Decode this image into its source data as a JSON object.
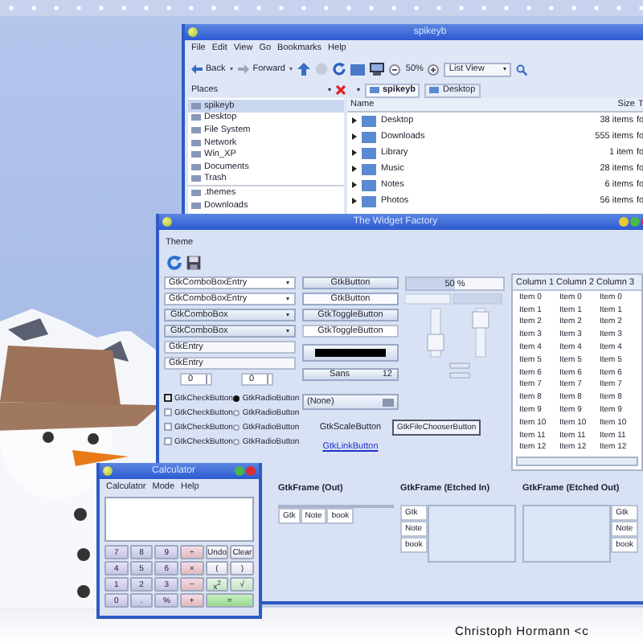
{
  "desktop": {
    "caption": "Christoph Hormann <c"
  },
  "file_manager": {
    "title": "spikeyb",
    "menu": [
      "File",
      "Edit",
      "View",
      "Go",
      "Bookmarks",
      "Help"
    ],
    "toolbar": {
      "back": "Back",
      "forward": "Forward",
      "zoom": "50%",
      "view": "List View"
    },
    "places": {
      "label": "Places",
      "items": [
        {
          "label": "spikeyb",
          "selected": true
        },
        {
          "label": "Desktop",
          "selected": false
        },
        {
          "label": "File System",
          "selected": false
        },
        {
          "label": "Network",
          "selected": false
        },
        {
          "label": "Win_XP",
          "selected": false
        },
        {
          "label": "Documents",
          "selected": false
        },
        {
          "label": "Trash",
          "selected": false
        },
        {
          "label": ".themes",
          "selected": false
        },
        {
          "label": "Downloads",
          "selected": false
        }
      ]
    },
    "path": [
      {
        "label": "spikeyb",
        "selected": true
      },
      {
        "label": "Desktop",
        "selected": false
      }
    ],
    "columns": [
      "Name",
      "Size",
      "T"
    ],
    "rows": [
      {
        "name": "Desktop",
        "size": "38 items",
        "type": "fo"
      },
      {
        "name": "Downloads",
        "size": "555 items",
        "type": "fo"
      },
      {
        "name": "Library",
        "size": "1 item",
        "type": "fo"
      },
      {
        "name": "Music",
        "size": "28 items",
        "type": "fo"
      },
      {
        "name": "Notes",
        "size": "6 items",
        "type": "fo"
      },
      {
        "name": "Photos",
        "size": "56 items",
        "type": "fo"
      }
    ]
  },
  "widget_factory": {
    "title": "The Widget Factory",
    "menu": [
      "Theme"
    ],
    "combos": [
      {
        "kind": "entry",
        "text": "GtkComboBoxEntry"
      },
      {
        "kind": "entry",
        "text": "GtkComboBoxEntry"
      },
      {
        "kind": "combo",
        "text": "GtkComboBox"
      },
      {
        "kind": "combo",
        "text": "GtkComboBox"
      }
    ],
    "entries": [
      "GtkEntry",
      "GtkEntry"
    ],
    "spins": [
      "0",
      "0"
    ],
    "checks": [
      {
        "label": "GtkCheckButton",
        "checked": true
      },
      {
        "label": "GtkCheckButton",
        "checked": false
      },
      {
        "label": "GtkCheckButton",
        "checked": false
      },
      {
        "label": "GtkCheckButton",
        "checked": false
      }
    ],
    "radios": [
      {
        "label": "GtkRadioButton",
        "selected": true
      },
      {
        "label": "GtkRadioButton",
        "selected": false
      },
      {
        "label": "GtkRadioButton",
        "selected": false
      },
      {
        "label": "GtkRadioButton",
        "selected": false
      }
    ],
    "buttons": [
      {
        "kind": "normal",
        "label": "GtkButton"
      },
      {
        "kind": "flat",
        "label": "GtkButton"
      },
      {
        "kind": "toggle",
        "label": "GtkToggleButton",
        "on": false
      },
      {
        "kind": "toggle",
        "label": "GtkToggleButton",
        "on": true
      }
    ],
    "font_button": {
      "name": "Sans",
      "size": "12"
    },
    "file_chooser": "(None)",
    "tooltip": "GtkFileChooserButton",
    "scale_button": "GtkScaleButton",
    "link_button": "GtkLinkButton",
    "progress": {
      "level": 0.5,
      "text": "50 %"
    },
    "tree": {
      "columns": [
        "Column 1",
        "Column 2",
        "Column 3"
      ],
      "rows": [
        [
          "Item 0",
          "Item 0",
          "Item 0"
        ],
        [
          "Item 1",
          "Item 1",
          "Item 1"
        ],
        [
          "Item 2",
          "Item 2",
          "Item 2"
        ],
        [
          "Item 3",
          "Item 3",
          "Item 3"
        ],
        [
          "Item 4",
          "Item 4",
          "Item 4"
        ],
        [
          "Item 5",
          "Item 5",
          "Item 5"
        ],
        [
          "Item 6",
          "Item 6",
          "Item 6"
        ],
        [
          "Item 7",
          "Item 7",
          "Item 7"
        ],
        [
          "Item 8",
          "Item 8",
          "Item 8"
        ],
        [
          "Item 9",
          "Item 9",
          "Item 9"
        ],
        [
          "Item 10",
          "Item 10",
          "Item 10"
        ],
        [
          "Item 11",
          "Item 11",
          "Item 11"
        ],
        [
          "Item 12",
          "Item 12",
          "Item 12"
        ]
      ]
    },
    "frames": [
      {
        "title": "GtkFrame (Out)",
        "kind": "bottom",
        "tabs": [
          "Gtk",
          "Note",
          "book"
        ]
      },
      {
        "title": "GtkFrame (Etched In)",
        "kind": "left",
        "tabs": [
          "Gtk",
          "Note",
          "book"
        ]
      },
      {
        "title": "GtkFrame (Etched Out)",
        "kind": "right",
        "tabs": [
          "Gtk",
          "Note",
          "book"
        ]
      }
    ]
  },
  "calculator": {
    "title": "Calculator",
    "menu": [
      "Calculator",
      "Mode",
      "Help"
    ],
    "keys": [
      {
        "label": "7",
        "kind": "digit"
      },
      {
        "label": "8",
        "kind": "digit"
      },
      {
        "label": "9",
        "kind": "digit"
      },
      {
        "label": "÷",
        "kind": "operator"
      },
      {
        "label": "Undo",
        "kind": "function"
      },
      {
        "label": "Clear",
        "kind": "function"
      },
      {
        "label": "4",
        "kind": "digit"
      },
      {
        "label": "5",
        "kind": "digit"
      },
      {
        "label": "6",
        "kind": "digit"
      },
      {
        "label": "×",
        "kind": "operator"
      },
      {
        "label": "(",
        "kind": "function"
      },
      {
        "label": ")",
        "kind": "function"
      },
      {
        "label": "1",
        "kind": "digit"
      },
      {
        "label": "2",
        "kind": "digit"
      },
      {
        "label": "3",
        "kind": "digit"
      },
      {
        "label": "−",
        "kind": "operator"
      },
      {
        "label": "x$^{2}$",
        "kind": "science"
      },
      {
        "label": "√",
        "kind": "science"
      },
      {
        "label": "0",
        "kind": "digit"
      },
      {
        "label": ".",
        "kind": "digit"
      },
      {
        "label": "%",
        "kind": "digit"
      },
      {
        "label": "+",
        "kind": "operator"
      },
      {
        "label": "=",
        "kind": "equals"
      }
    ]
  }
}
